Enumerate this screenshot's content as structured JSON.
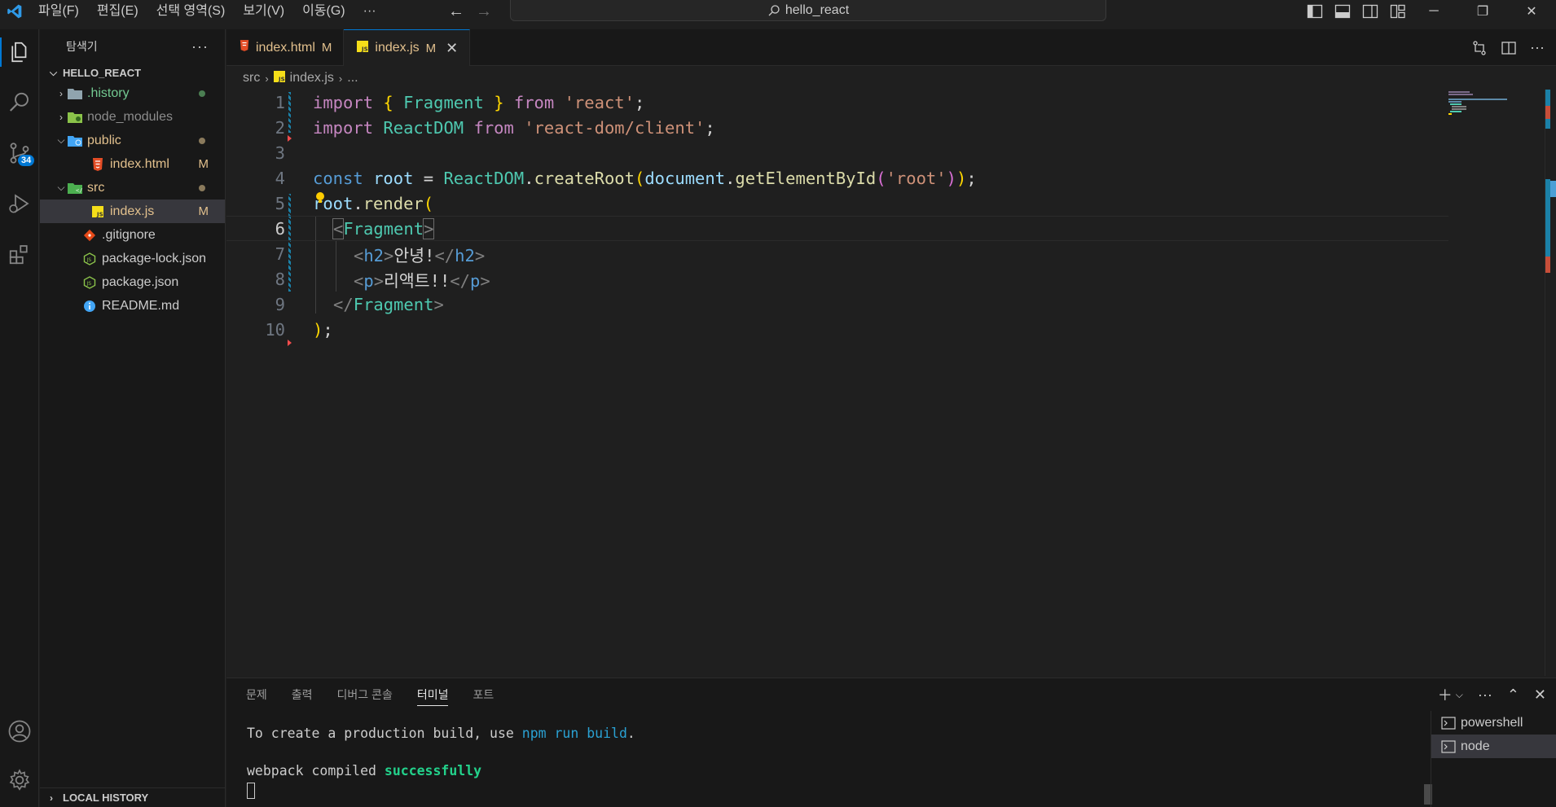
{
  "title_bar": {
    "menus": [
      "파일(F)",
      "편집(E)",
      "선택 영역(S)",
      "보기(V)",
      "이동(G)",
      "···"
    ],
    "search_text": "hello_react"
  },
  "activity_bar": {
    "scm_badge": "34"
  },
  "explorer": {
    "header": "탐색기",
    "more": "···",
    "project": "HELLO_REACT",
    "items": [
      {
        "label": ".history",
        "indent": 1
      },
      {
        "label": "node_modules",
        "indent": 1
      },
      {
        "label": "public",
        "indent": 1
      },
      {
        "label": "index.html",
        "indent": 2,
        "badge": "M"
      },
      {
        "label": "src",
        "indent": 1
      },
      {
        "label": "index.js",
        "indent": 2,
        "badge": "M"
      },
      {
        "label": ".gitignore",
        "indent": 1
      },
      {
        "label": "package-lock.json",
        "indent": 1
      },
      {
        "label": "package.json",
        "indent": 1
      },
      {
        "label": "README.md",
        "indent": 1
      }
    ],
    "local_history": "LOCAL HISTORY"
  },
  "tabs": [
    {
      "label": "index.html",
      "badge": "M"
    },
    {
      "label": "index.js",
      "badge": "M",
      "active": true
    }
  ],
  "breadcrumb": {
    "folder": "src",
    "file": "index.js",
    "more": "..."
  },
  "editor": {
    "line_numbers": [
      "1",
      "2",
      "3",
      "4",
      "5",
      "6",
      "7",
      "8",
      "9",
      "10"
    ],
    "current_line": "6",
    "code": {
      "l1": [
        "import",
        "{",
        "Fragment",
        "}",
        "from",
        "'react'",
        ";"
      ],
      "l2": [
        "import",
        "ReactDOM",
        "from",
        "'react-dom/client'",
        ";"
      ],
      "l4": [
        "const",
        "root",
        "=",
        "ReactDOM",
        ".",
        "createRoot",
        "(",
        "document",
        ".",
        "getElementById",
        "(",
        "'root'",
        ")",
        ")",
        ";"
      ],
      "l5": [
        "root",
        ".",
        "render",
        "("
      ],
      "l6": [
        "<",
        "Fragment",
        ">"
      ],
      "l7": [
        "<",
        "h2",
        ">",
        "안녕!",
        "</",
        "h2",
        ">"
      ],
      "l8": [
        "<",
        "p",
        ">",
        "리액트!!",
        "</",
        "p",
        ">"
      ],
      "l9": [
        "</",
        "Fragment",
        ">"
      ],
      "l10": [
        ")",
        ";"
      ]
    }
  },
  "panel": {
    "tabs": [
      "문제",
      "출력",
      "디버그 콘솔",
      "터미널",
      "포트"
    ],
    "active_tab": "터미널",
    "terminal": {
      "line1_prefix": "To create a production build, use ",
      "line1_cmd": "npm run build",
      "line1_suffix": ".",
      "line2_prefix": "webpack compiled ",
      "line2_status": "successfully"
    },
    "terminals": [
      "powershell",
      "node"
    ],
    "active_terminal": "node"
  },
  "colors": {
    "accent": "#0078d4",
    "modified": "#e2c08d",
    "untracked": "#73c991",
    "success": "#23d18b"
  }
}
